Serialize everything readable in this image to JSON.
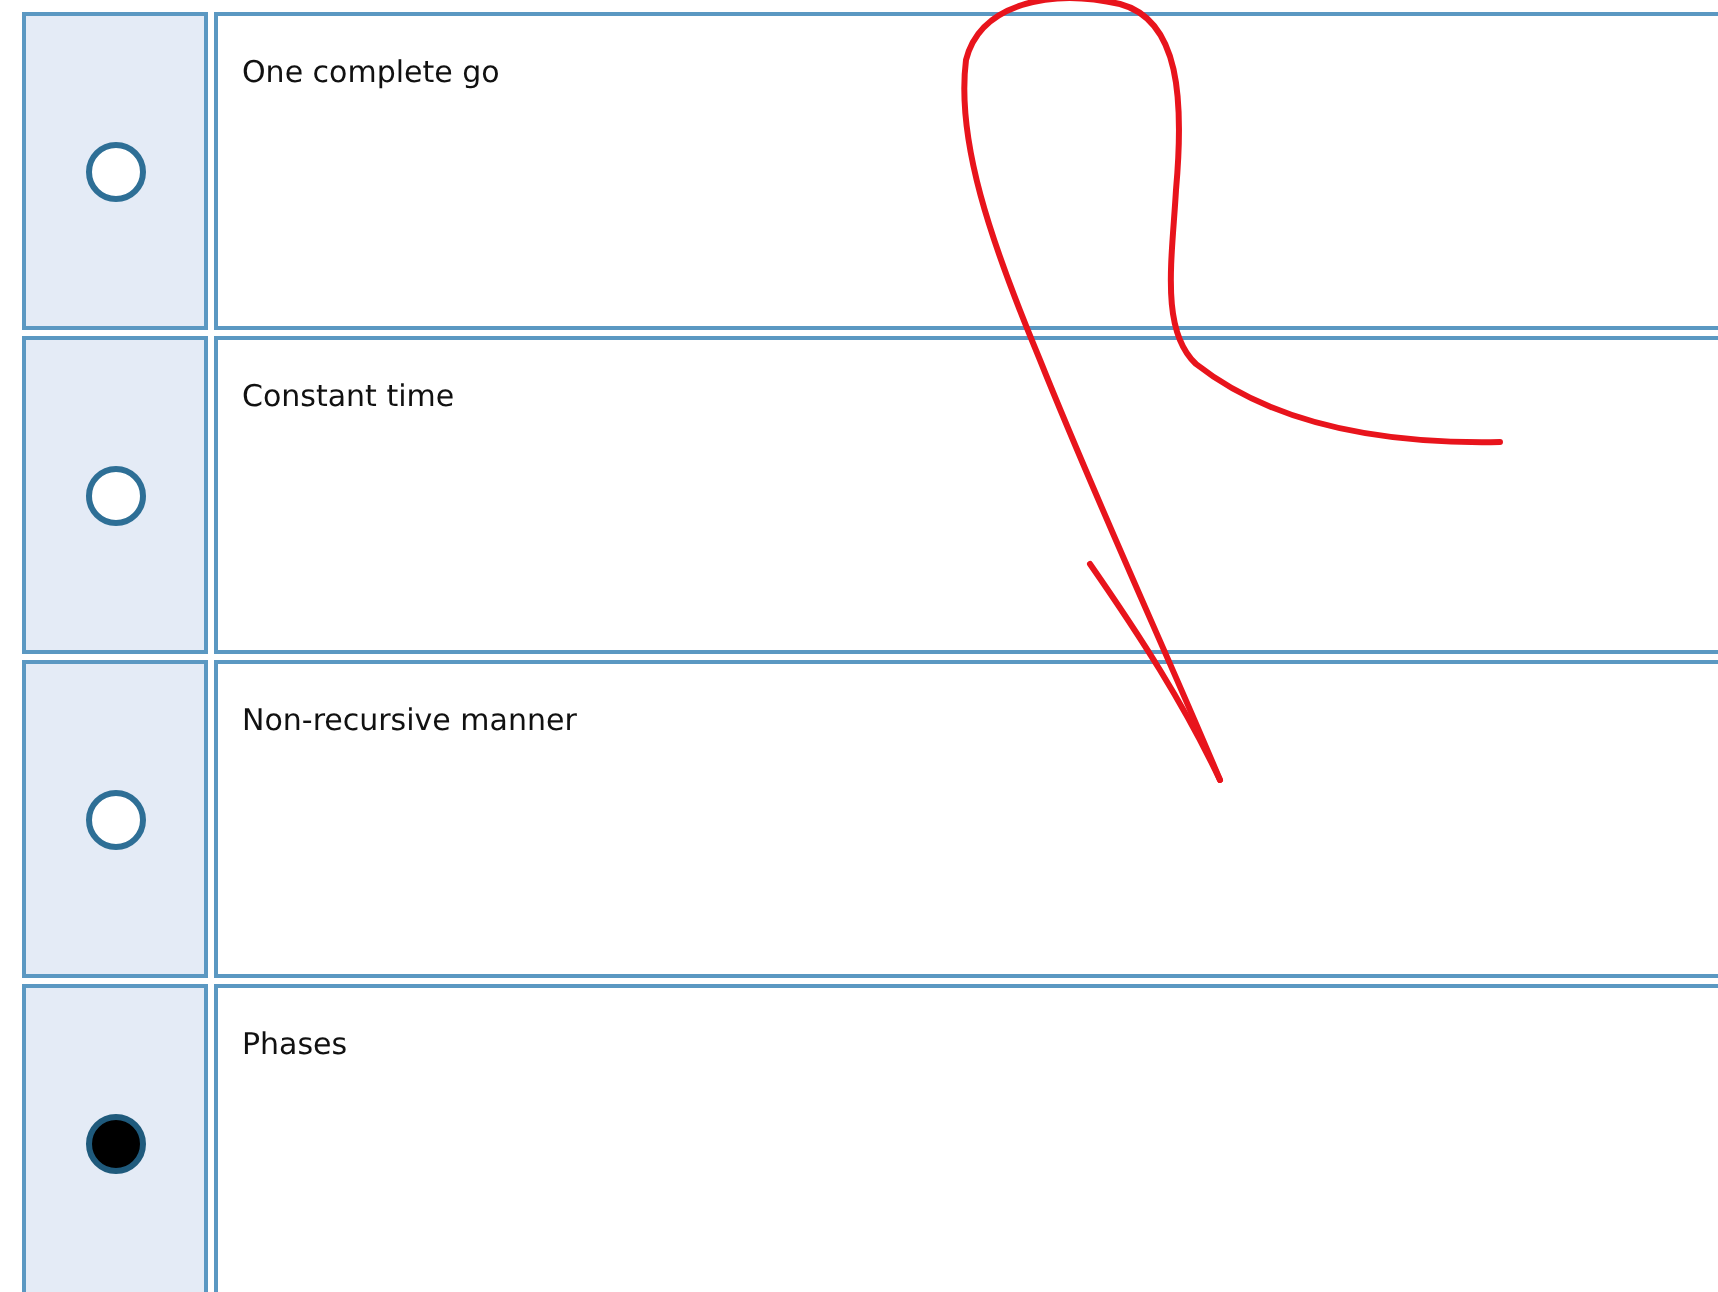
{
  "options": [
    {
      "label": "One complete go",
      "selected": false
    },
    {
      "label": "Constant time",
      "selected": false
    },
    {
      "label": "Non-recursive manner",
      "selected": false
    },
    {
      "label": "Phases",
      "selected": true
    }
  ]
}
